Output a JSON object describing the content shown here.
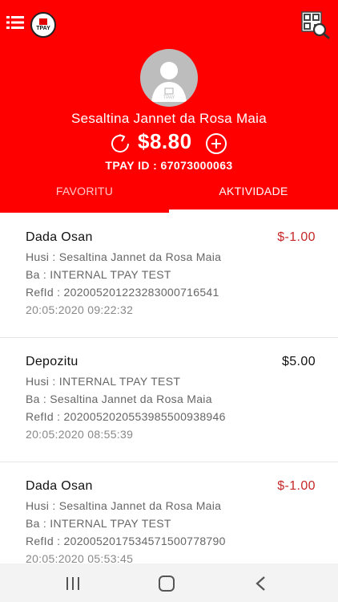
{
  "header": {
    "logo_text": "TPAY",
    "user_name": "Sesaltina Jannet da Rosa Maia",
    "balance": "$8.80",
    "tpay_id": "TPAY ID : 67073000063",
    "accent_color": "#ff0000"
  },
  "tabs": [
    {
      "label": "FAVORITU",
      "active": false
    },
    {
      "label": "AKTIVIDADE",
      "active": true
    }
  ],
  "transactions": [
    {
      "title": "Dada Osan",
      "amount": "$-1.00",
      "line1": "Husi : Sesaltina Jannet da Rosa Maia",
      "line2": "Ba : INTERNAL TPAY TEST",
      "line3": "RefId : 20200520122328300071654​1",
      "timestamp": "20:05:2020 09:22:32"
    },
    {
      "title": "Depozitu",
      "amount": "$5.00",
      "line1": "Husi : INTERNAL TPAY TEST",
      "line2": "Ba : Sesaltina Jannet da Rosa Maia",
      "line3": "RefId : 20200520205539855009389​46",
      "timestamp": "20:05:2020 08:55:39"
    },
    {
      "title": "Dada Osan",
      "amount": "$-1.00",
      "line1": "Husi : Sesaltina Jannet da Rosa Maia",
      "line2": "Ba : INTERNAL TPAY TEST",
      "line3": "RefId : 20200520175345715007787​90",
      "timestamp": "20:05:2020 05:53:45"
    }
  ],
  "icons": {
    "menu": "menu-list-icon",
    "qr": "qr-search-icon",
    "refresh": "refresh-icon",
    "add": "add-circle-icon",
    "avatar": "user-avatar-icon"
  },
  "colors": {
    "negative_amount": "#c62828",
    "positive_amount": "#111111"
  }
}
